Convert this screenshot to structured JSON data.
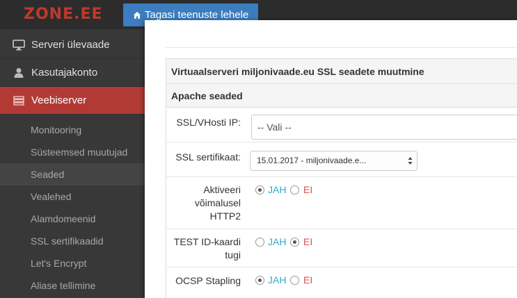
{
  "brand": {
    "logo_text": "ZONE.EE"
  },
  "topbar": {
    "back_button": "Tagasi teenuste lehele"
  },
  "sidebar": {
    "items": [
      {
        "label": "Serveri ülevaade",
        "icon": "monitor-icon"
      },
      {
        "label": "Kasutajakonto",
        "icon": "user-icon"
      },
      {
        "label": "Veebiserver",
        "icon": "server-icon",
        "active": true
      }
    ],
    "subitems": [
      {
        "label": "Monitooring"
      },
      {
        "label": "Süsteemsed muutujad"
      },
      {
        "label": "Seaded",
        "selected": true
      },
      {
        "label": "Vealehed"
      },
      {
        "label": "Alamdomeenid"
      },
      {
        "label": "SSL sertifikaadid"
      },
      {
        "label": "Let's Encrypt"
      },
      {
        "label": "Aliase tellimine"
      }
    ]
  },
  "panel": {
    "title": "Virtuaalserveri miljonivaade.eu SSL seadete muutmine",
    "section": "Apache seaded",
    "fields": {
      "ssl_ip": {
        "label": "SSL/VHosti IP:",
        "value": "-- Vali --"
      },
      "ssl_cert": {
        "label": "SSL sertifikaat:",
        "value": "15.01.2017 - miljonivaade.e..."
      },
      "http2": {
        "label": "Aktiveeri võimalusel HTTP2",
        "yes": "JAH",
        "no": "EI",
        "selected": "JAH"
      },
      "test_id": {
        "label": "TEST ID-kaardi tugi",
        "yes": "JAH",
        "no": "EI",
        "selected": "EI"
      },
      "ocsp": {
        "label": "OCSP Stapling",
        "yes": "JAH",
        "no": "EI",
        "selected": "JAH"
      }
    }
  },
  "colors": {
    "accent": "#b23a35",
    "button": "#3c7dbf",
    "yes": "#31a9c9",
    "no": "#d9534f"
  }
}
